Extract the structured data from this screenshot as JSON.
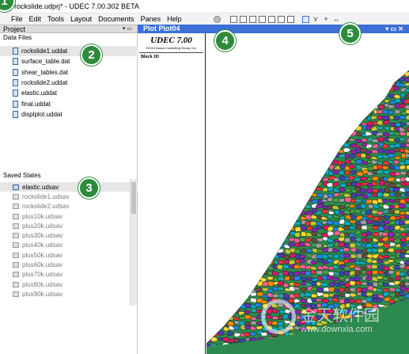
{
  "window": {
    "title": "rockslide.udprj* - UDEC 7.00.302 BETA"
  },
  "menu": {
    "items": [
      {
        "label": "File",
        "name": "menu-file"
      },
      {
        "label": "Edit",
        "name": "menu-edit"
      },
      {
        "label": "Tools",
        "name": "menu-tools"
      },
      {
        "label": "Layout",
        "name": "menu-layout"
      },
      {
        "label": "Documents",
        "name": "menu-documents"
      },
      {
        "label": "Panes",
        "name": "menu-panes"
      },
      {
        "label": "Help",
        "name": "menu-help"
      }
    ]
  },
  "toolbar": {
    "icons": [
      "record-icon",
      "table-icon",
      "grid-icon",
      "grid-icon",
      "page-icon",
      "print-icon",
      "image-icon",
      "check-icon",
      "pointer-icon",
      "select-icon",
      "add-icon",
      "measure-icon"
    ]
  },
  "project_pane": {
    "title": "Project",
    "header_buttons": "▾ ▭",
    "data_files_label": "Data Files",
    "data_files": [
      {
        "name": "rockslide1.uddat",
        "selected": true
      },
      {
        "name": "surface_table.dat",
        "selected": false
      },
      {
        "name": "shear_tables.dat",
        "selected": false
      },
      {
        "name": "rockslide2.uddat",
        "selected": false
      },
      {
        "name": "elastic.uddat",
        "selected": false
      },
      {
        "name": "final.uddat",
        "selected": false
      },
      {
        "name": "displplot.uddat",
        "selected": false
      }
    ],
    "saved_states_label": "Saved States",
    "saved_states": [
      {
        "name": "elastic.udsav",
        "selected": true
      },
      {
        "name": "rockslide1.udsav",
        "selected": false
      },
      {
        "name": "rockslide2.udsav",
        "selected": false
      },
      {
        "name": "plus10k.udsav",
        "selected": false
      },
      {
        "name": "plus20k.udsav",
        "selected": false
      },
      {
        "name": "plus30k.udsav",
        "selected": false
      },
      {
        "name": "plus40k.udsav",
        "selected": false
      },
      {
        "name": "plus50k.udsav",
        "selected": false
      },
      {
        "name": "plus60k.udsav",
        "selected": false
      },
      {
        "name": "plus70k.udsav",
        "selected": false
      },
      {
        "name": "plus80k.udsav",
        "selected": false
      },
      {
        "name": "plus90k.udsav",
        "selected": false
      }
    ]
  },
  "plot": {
    "title": "Plot Plot04",
    "header_buttons": "▾ ▭ ✕",
    "legend_title": "UDEC 7.00",
    "legend_copyright": "©2010 Itasca Consulting Group, Inc.",
    "legend_item": "Block ID",
    "colors": {
      "slope": "#2c8a4e",
      "header": "#3c6fd8"
    }
  },
  "callouts": [
    "1",
    "2",
    "3",
    "4",
    "5"
  ],
  "watermark": {
    "text": "金天软件园",
    "url": "www.downxia.com"
  }
}
